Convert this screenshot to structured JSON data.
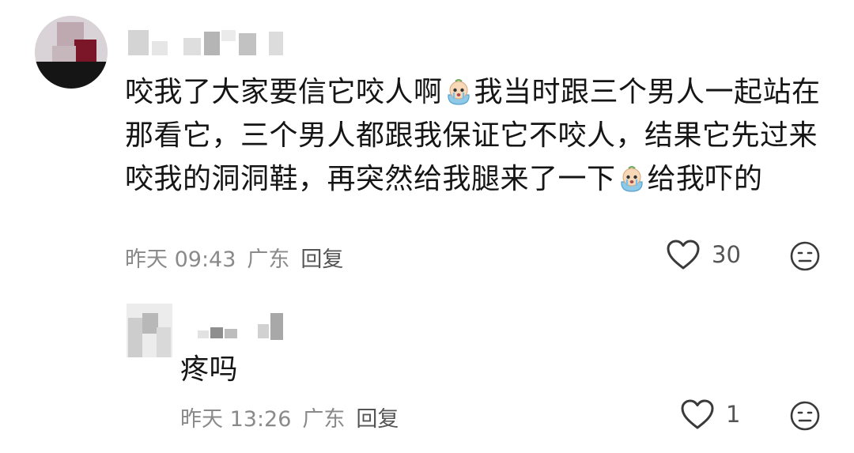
{
  "comment": {
    "text_part1": "咬我了大家要信它咬人啊",
    "text_part2": "我当时跟三个男人一起站在那看它，三个男人都跟我保证它不咬人，结果它先过来咬我的洞洞鞋，再突然给我腿来了一下",
    "text_part3": "给我吓的",
    "emoji_name": "crying-bag-emoji",
    "date": "昨天 09:43",
    "location": "广东",
    "reply_label": "回复",
    "like_count": "30"
  },
  "reply": {
    "text": "疼吗",
    "date": "昨天 13:26",
    "location": "广东",
    "reply_label": "回复",
    "like_count": "1"
  },
  "icons": {
    "like": "heart-outline-icon",
    "dislike": "neutral-face-icon"
  },
  "colors": {
    "text": "#151515",
    "meta": "#8a8a8a",
    "icon": "#3a3a3a"
  }
}
